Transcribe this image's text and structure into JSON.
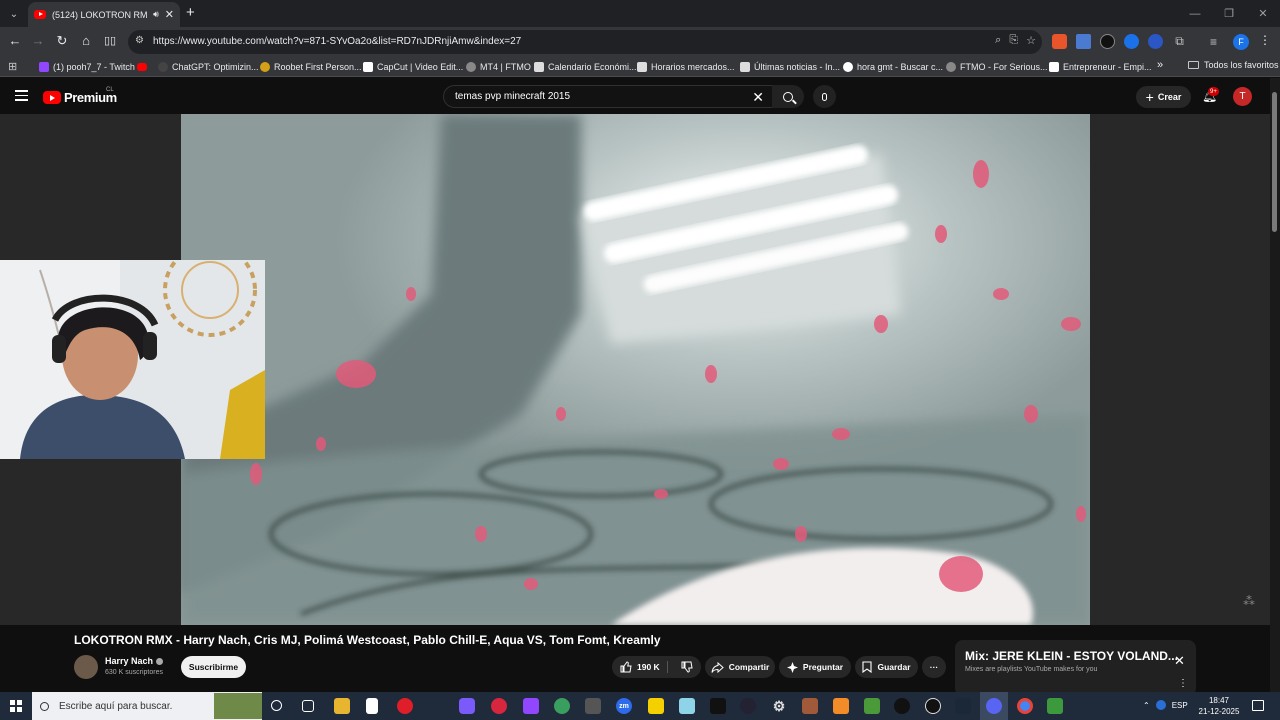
{
  "browser": {
    "tab": {
      "title": "(5124) LOKOTRON RMX - H",
      "audio_icon": "speaker-icon",
      "close": "✕"
    },
    "new_tab": "+",
    "window_controls": [
      "—",
      "❐",
      "✕"
    ],
    "url": "https://www.youtube.com/watch?v=871-SYvOa2o&list=RD7nJDRnjiAmw&index=27",
    "bookmarks": [
      {
        "label": "(1) pooh7_7 - Twitch",
        "color": "#9146ff"
      },
      {
        "label": "",
        "color": "#ff0000"
      },
      {
        "label": "ChatGPT: Optimizin...",
        "color": "#444444"
      },
      {
        "label": "Roobet First Person...",
        "color": "#d4a017"
      },
      {
        "label": "CapCut | Video Edit...",
        "color": "#ffffff"
      },
      {
        "label": "MT4 | FTMO",
        "color": "#888888"
      },
      {
        "label": "Calendario Económi...",
        "color": "#dddddd"
      },
      {
        "label": "Horarios mercados...",
        "color": "#dddddd"
      },
      {
        "label": "Últimas noticias - In...",
        "color": "#dddddd"
      },
      {
        "label": "hora gmt - Buscar c...",
        "color": "#ffffff"
      },
      {
        "label": "FTMO - For Serious...",
        "color": "#888888"
      },
      {
        "label": "Entrepreneur - Empi...",
        "color": "#ffffff"
      }
    ],
    "bookmarks_more": "»",
    "all_bookmarks": "Todos los favoritos",
    "profile_initial": "F"
  },
  "youtube": {
    "logo_text": "Premium",
    "logo_region": "CL",
    "search_value": "temas pvp minecraft 2015",
    "create_label": "Crear",
    "notifications_badge": "9+",
    "avatar_initial": "T"
  },
  "video": {
    "title": "LOKOTRON RMX - Harry Nach, Cris MJ, Polimá Westcoast, Pablo Chill-E, Aqua VS, Tom Fomt, Kreamly",
    "channel": "Harry Nach",
    "subscribers": "630 K suscriptores",
    "subscribe_label": "Suscribirme",
    "likes": "190 K",
    "share_label": "Compartir",
    "ask_label": "Preguntar",
    "save_label": "Guardar"
  },
  "mix": {
    "title": "Mix: JERE KLEIN - ESTOY VOLAND...",
    "subtitle": "Mixes are playlists YouTube makes for you"
  },
  "taskbar": {
    "search_placeholder": "Escribe aquí para buscar.",
    "language": "ESP",
    "time": "18:47",
    "date": "21-12-2025"
  }
}
